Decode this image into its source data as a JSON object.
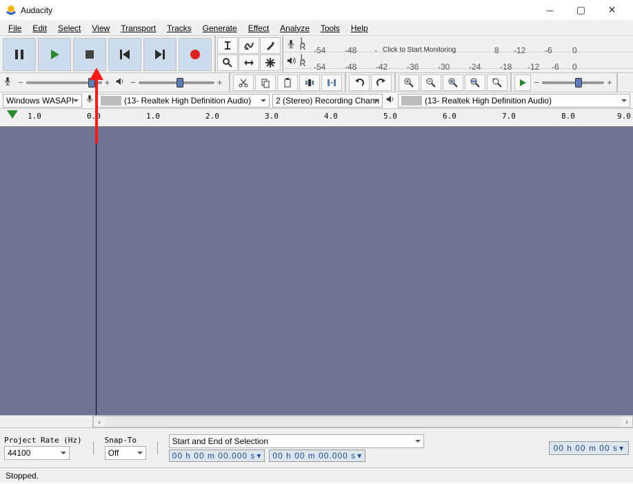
{
  "window": {
    "title": "Audacity"
  },
  "menus": [
    "File",
    "Edit",
    "Select",
    "View",
    "Transport",
    "Tracks",
    "Generate",
    "Effect",
    "Analyze",
    "Tools",
    "Help"
  ],
  "meter": {
    "ticks": [
      "-54",
      "-48",
      "-42",
      "-36",
      "-30",
      "-24",
      "-18",
      "-12",
      "-6",
      "0"
    ],
    "rec_ticks_prefix": [
      "-54",
      "-48",
      "-"
    ],
    "rec_ticks_suffix": [
      "8",
      "-12",
      "-6",
      "0"
    ],
    "click_label": "Click to Start Monitoring",
    "L": "L",
    "R": "R"
  },
  "sliders": {
    "minus": "−",
    "plus": "+"
  },
  "devices": {
    "host": "Windows WASAPI",
    "rec_device": "(13- Realtek High Definition Audio)",
    "rec_channels": "2 (Stereo) Recording Chann",
    "play_device": "(13- Realtek High Definition Audio)"
  },
  "ruler": {
    "marks": [
      "1.0",
      "0.0",
      "1.0",
      "2.0",
      "3.0",
      "4.0",
      "5.0",
      "6.0",
      "7.0",
      "8.0",
      "9.0"
    ]
  },
  "selection": {
    "rate_label": "Project Rate (Hz)",
    "rate_value": "44100",
    "snap_label": "Snap-To",
    "snap_value": "Off",
    "mode_label": "Start and End of Selection",
    "time_a": "00 h 00 m 00.000 s",
    "time_b": "00 h 00 m 00.000 s",
    "big_time": "00 h 00 m 00 s"
  },
  "status": "Stopped."
}
